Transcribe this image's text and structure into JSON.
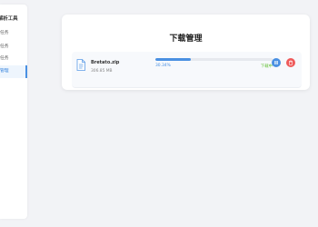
{
  "sidebar": {
    "title": "解析工具",
    "items": [
      {
        "label": "任务",
        "active": false
      },
      {
        "label": "任务",
        "active": false
      },
      {
        "label": "任务",
        "active": false
      },
      {
        "label": "管理",
        "active": true
      }
    ]
  },
  "main": {
    "title": "下载管理",
    "download": {
      "file_name": "Bretato.zip",
      "file_size": "306.85 MB",
      "progress_percent": 30.34,
      "progress_text": "30.34%",
      "status": "下载中",
      "status_color": "#67c23a",
      "accent_color": "#4a90e2",
      "pause_icon": "pause-icon",
      "delete_icon": "delete-icon"
    }
  }
}
